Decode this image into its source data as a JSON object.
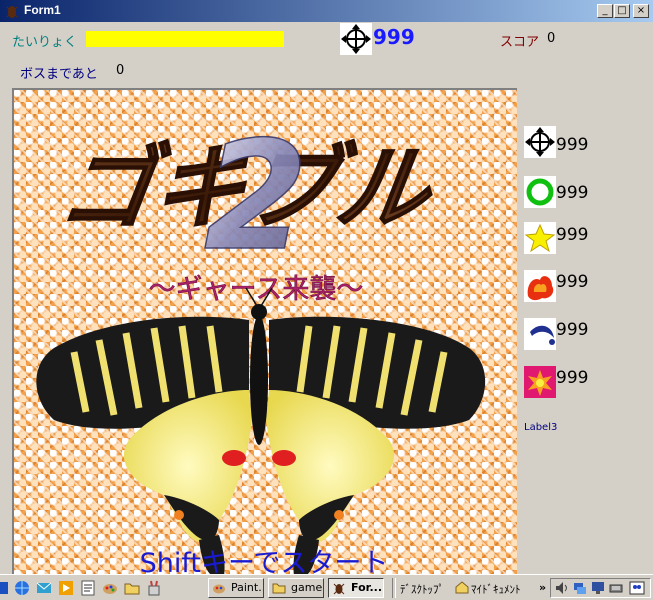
{
  "window": {
    "title": "Form1",
    "minimize": "_",
    "maximize": "□",
    "close": "×"
  },
  "hud": {
    "stamina_label": "たいりょく",
    "stamina_level": 1.0,
    "crosshair_count": "999",
    "score_label": "スコア",
    "score_value": "0",
    "boss_label": "ボスまであと",
    "boss_value": "0"
  },
  "items": [
    {
      "icon": "move-crosshair-icon",
      "count": "999"
    },
    {
      "icon": "green-ring-icon",
      "count": "999"
    },
    {
      "icon": "yellow-star-icon",
      "count": "999"
    },
    {
      "icon": "fire-splash-icon",
      "count": "999"
    },
    {
      "icon": "blue-boomerang-icon",
      "count": "999"
    },
    {
      "icon": "red-burst-icon",
      "count": "999"
    }
  ],
  "side_label": "Label3",
  "title_screen": {
    "title": "ゴキブル",
    "numeral": "2",
    "subtitle": "～ギャース来襲～",
    "prompt": "Shiftキーでスタート"
  },
  "taskbar": {
    "buttons": [
      {
        "label": "Paint..."
      },
      {
        "label": "game"
      },
      {
        "label": "For..."
      }
    ],
    "desktop": "ﾃﾞｽｸﾄｯﾌﾟ",
    "mydocs": "ﾏｲﾄﾞｷｭﾒﾝﾄ",
    "chevron": "»"
  },
  "colors": {
    "stamina_bar": "#ffff00",
    "titlebar": "#0a246a",
    "game_bg": "#f3a04a",
    "count_blue": "#1a1aff"
  }
}
